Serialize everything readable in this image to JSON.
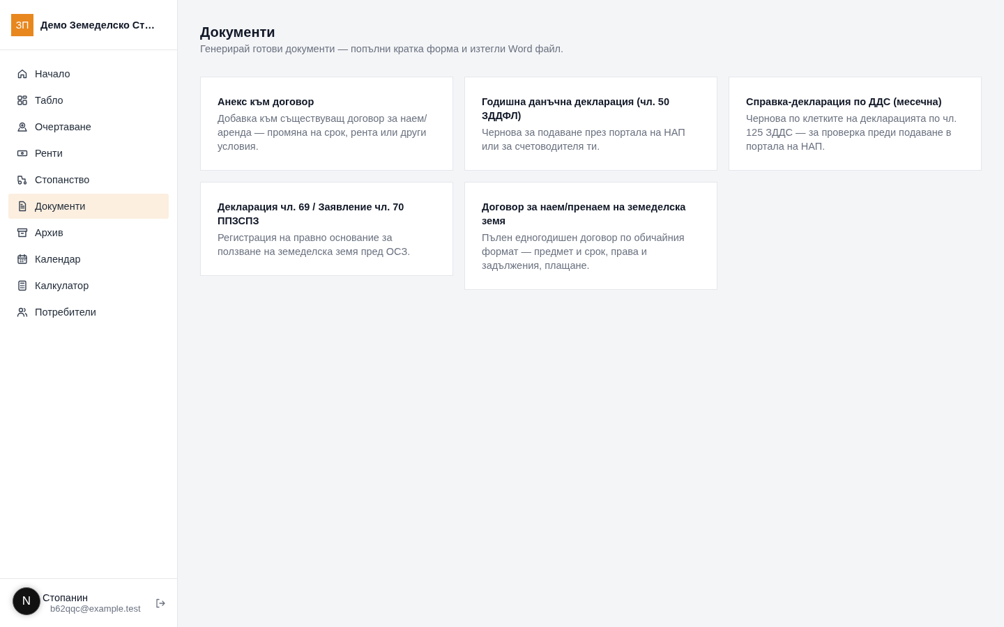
{
  "sidebar": {
    "logo": "ЗП",
    "org_name": "Демо Земеделско Ст…",
    "items": [
      {
        "label": "Начало",
        "selected": false
      },
      {
        "label": "Табло",
        "selected": false
      },
      {
        "label": "Очертаване",
        "selected": false
      },
      {
        "label": "Ренти",
        "selected": false
      },
      {
        "label": "Стопанство",
        "selected": false
      },
      {
        "label": "Документи",
        "selected": true
      },
      {
        "label": "Архив",
        "selected": false
      },
      {
        "label": "Календар",
        "selected": false
      },
      {
        "label": "Калкулатор",
        "selected": false
      },
      {
        "label": "Потребители",
        "selected": false
      }
    ],
    "user": {
      "name": "Стопанин",
      "email": "b62qqc@example.test",
      "badge": "N"
    }
  },
  "page": {
    "title": "Документи",
    "subtitle": "Генерирай готови документи — попълни кратка форма и изтегли Word файл.",
    "cards": [
      {
        "title": "Анекс към договор",
        "description": "Добавка към съществуващ договор за наем/аренда — промяна на срок, рента или други условия."
      },
      {
        "title": "Годишна данъчна декларация (чл. 50 ЗДДФЛ)",
        "description": "Чернова за подаване през портала на НАП или за счетоводителя ти."
      },
      {
        "title": "Справка-декларация по ДДС (месечна)",
        "description": "Чернова по клетките на декларацията по чл. 125 ЗДДС — за проверка преди подаване в портала на НАП."
      },
      {
        "title": "Декларация чл. 69 / Заявление чл. 70 ППЗСПЗ",
        "description": "Регистрация на правно основание за ползване на земеделска земя пред ОСЗ."
      },
      {
        "title": "Договор за наем/пренаем на земеделска земя",
        "description": "Пълен едногодишен договор по обичайния формат — предмет и срок, права и задължения, плащане."
      }
    ]
  }
}
